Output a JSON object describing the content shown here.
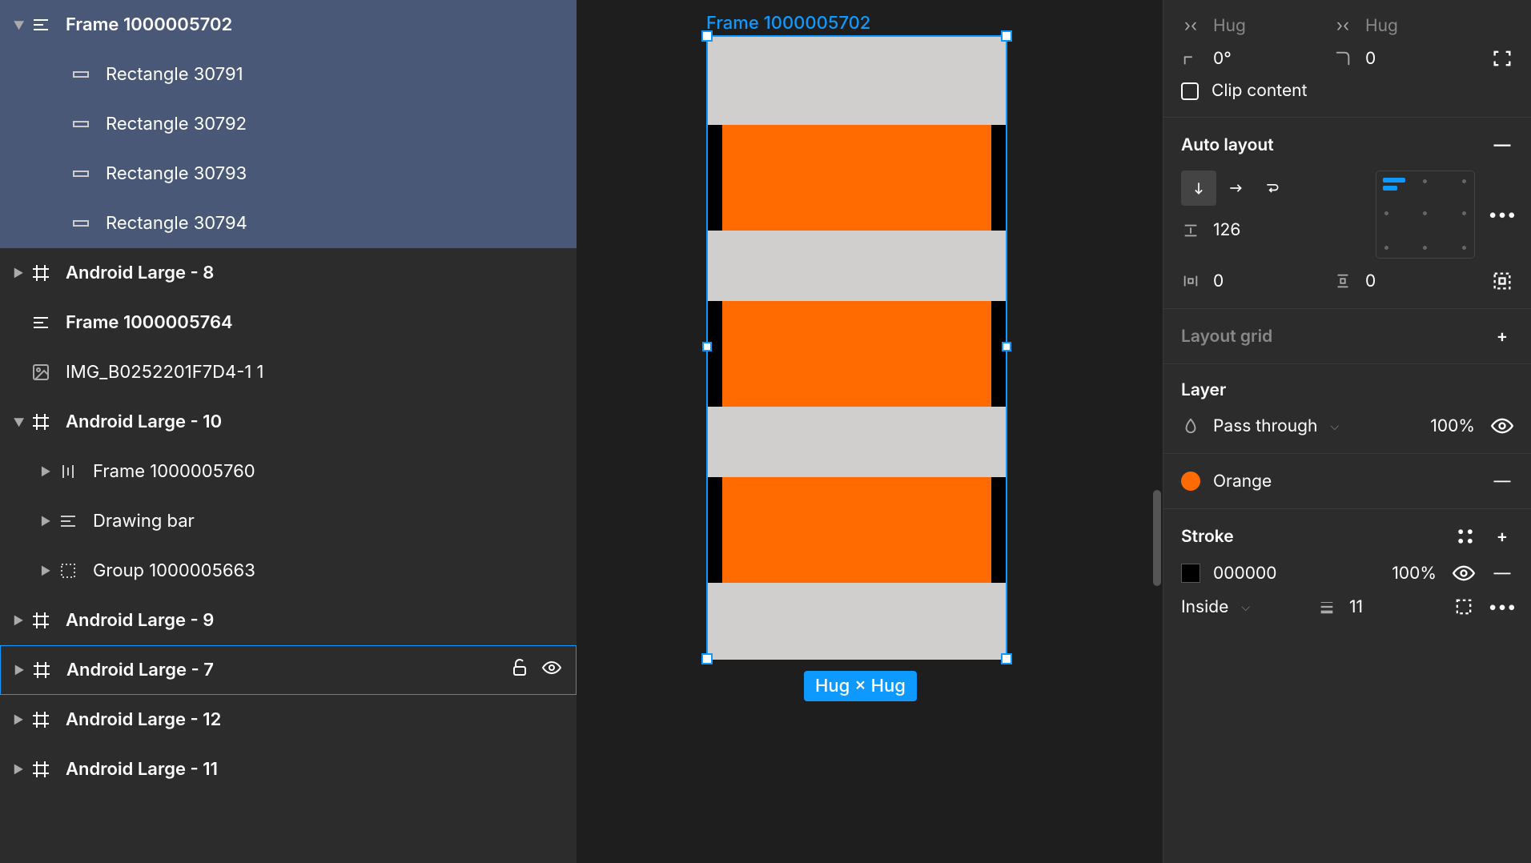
{
  "layers": {
    "frame_selected": "Frame 1000005702",
    "rect1": "Rectangle 30791",
    "rect2": "Rectangle 30792",
    "rect3": "Rectangle 30793",
    "rect4": "Rectangle 30794",
    "android8": "Android Large - 8",
    "frame5764": "Frame 1000005764",
    "img": "IMG_B0252201F7D4-1 1",
    "android10": "Android Large - 10",
    "frame5760": "Frame 1000005760",
    "drawing_bar": "Drawing bar",
    "group5663": "Group 1000005663",
    "android9": "Android Large - 9",
    "android7": "Android Large - 7",
    "android12": "Android Large - 12",
    "android11": "Android Large - 11"
  },
  "canvas": {
    "frame_label": "Frame 1000005702",
    "selection_badge": "Hug × Hug"
  },
  "props": {
    "hug1": "Hug",
    "hug2": "Hug",
    "rotation": "0°",
    "corner": "0",
    "clip_content": "Clip content",
    "auto_layout_title": "Auto layout",
    "gap": "126",
    "pad_h": "0",
    "pad_v": "0",
    "layout_grid_title": "Layout grid",
    "layer_title": "Layer",
    "blend_mode": "Pass through",
    "opacity": "100%",
    "fill_name": "Orange",
    "fill_color": "#ff6b00",
    "stroke_title": "Stroke",
    "stroke_hex": "000000",
    "stroke_opacity": "100%",
    "stroke_position": "Inside",
    "stroke_width": "11"
  }
}
